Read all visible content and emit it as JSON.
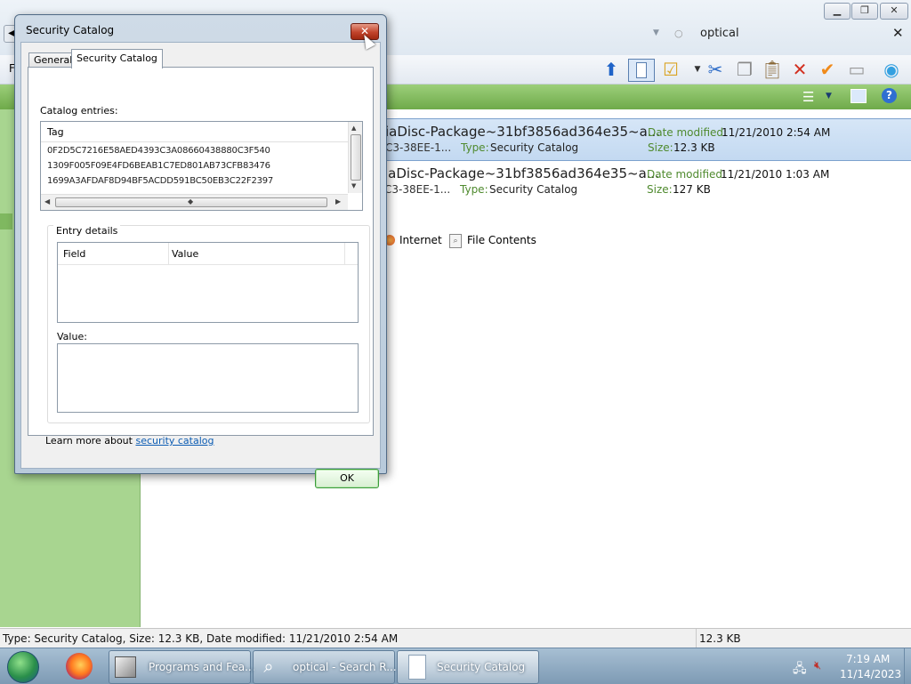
{
  "explorer": {
    "search_query": "optical",
    "results": [
      {
        "name": "iaDisc-Package~31bf3856ad364e35~a...",
        "sub": "C3-38EE-1...",
        "type_label": "Type:",
        "type_value": "Security Catalog",
        "date_label": "Date modified:",
        "date_value": "11/21/2010 2:54 AM",
        "size_label": "Size:",
        "size_value": "12.3 KB"
      },
      {
        "name": "iaDisc-Package~31bf3856ad364e35~a...",
        "sub": "C3-38EE-1...",
        "type_label": "Type:",
        "type_value": "Security Catalog",
        "date_label": "Date modified:",
        "date_value": "11/21/2010 1:03 AM",
        "size_label": "Size:",
        "size_value": "127 KB"
      }
    ],
    "search_again": {
      "internet": "Internet",
      "file_contents": "File Contents"
    },
    "menu_first_letter": "F",
    "status": {
      "text": "Type: Security Catalog, Size: 12.3 KB, Date modified: 11/21/2010 2:54 AM",
      "size": "12.3 KB"
    }
  },
  "dialog": {
    "title": "Security Catalog",
    "tabs": [
      "General",
      "Security Catalog"
    ],
    "catalog_entries_label": "Catalog entries:",
    "catalog_column": "Tag",
    "catalog_rows": [
      "0F2D5C7216E58AED4393C3A08660438880C3F540",
      "1309F005F09E4FD6BEAB1C7ED801AB73CFB83476",
      "1699A3AFDAF8D94BF5ACDD591BC50EB3C22F2397"
    ],
    "entry_details_label": "Entry details",
    "details_columns": [
      "Field",
      "Value"
    ],
    "value_label": "Value:",
    "learn_more_prefix": "Learn more about ",
    "learn_more_link": "security catalog",
    "ok_label": "OK"
  },
  "taskbar": {
    "buttons": [
      "Programs and Fea...",
      "optical - Search R...",
      "Security Catalog"
    ],
    "time": "7:19 AM",
    "date": "11/14/2023"
  }
}
